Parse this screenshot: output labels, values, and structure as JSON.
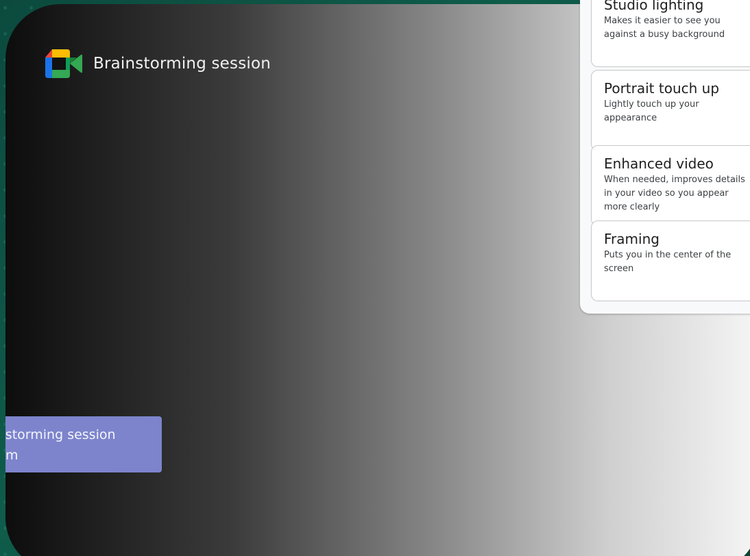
{
  "meeting": {
    "title": "Brainstorming session"
  },
  "effects_panel": {
    "cards": [
      {
        "title": "Studio lighting",
        "description": "Makes it easier to see you against a busy background"
      },
      {
        "title": "Portrait touch up",
        "description": "Lightly touch up your appearance"
      },
      {
        "title": "Enhanced video",
        "description": "When needed, improves details in your video so you appear more clearly"
      },
      {
        "title": "Framing",
        "description": "Puts you in the center of the screen"
      }
    ]
  },
  "tooltip": {
    "line1": "Brainstorming session",
    "line2": "m"
  },
  "icons": {
    "app_logo": "google-meet-icon"
  },
  "colors": {
    "background_green": "#0f5c4b",
    "tooltip_purple": "#7d84cc",
    "panel_background": "#f8f9fb",
    "card_border": "#c7c7c7"
  }
}
